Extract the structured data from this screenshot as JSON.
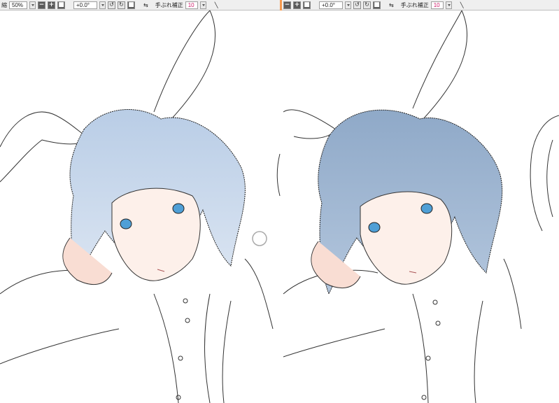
{
  "left_toolbar": {
    "zoom_label": "縮",
    "zoom_value": "50%",
    "rotation_value": "+0.0°",
    "stabilizer_label": "手ぶれ補正",
    "stabilizer_value": "10"
  },
  "right_toolbar": {
    "zoom_value": "+0.0°",
    "stabilizer_label": "手ぶれ補正",
    "stabilizer_value": "10"
  },
  "icons": {
    "minus": "−",
    "plus": "+",
    "stop": "■",
    "rotate_ccw": "↺",
    "reset": "↻",
    "swap": "⇆",
    "pen": "╲"
  },
  "colors": {
    "accent_divider": "#f59a50",
    "hair_light": "#cfdcee",
    "hair_dark": "#8ea8c6",
    "skin": "#fbe9e3",
    "eye": "#4f9fd6"
  }
}
